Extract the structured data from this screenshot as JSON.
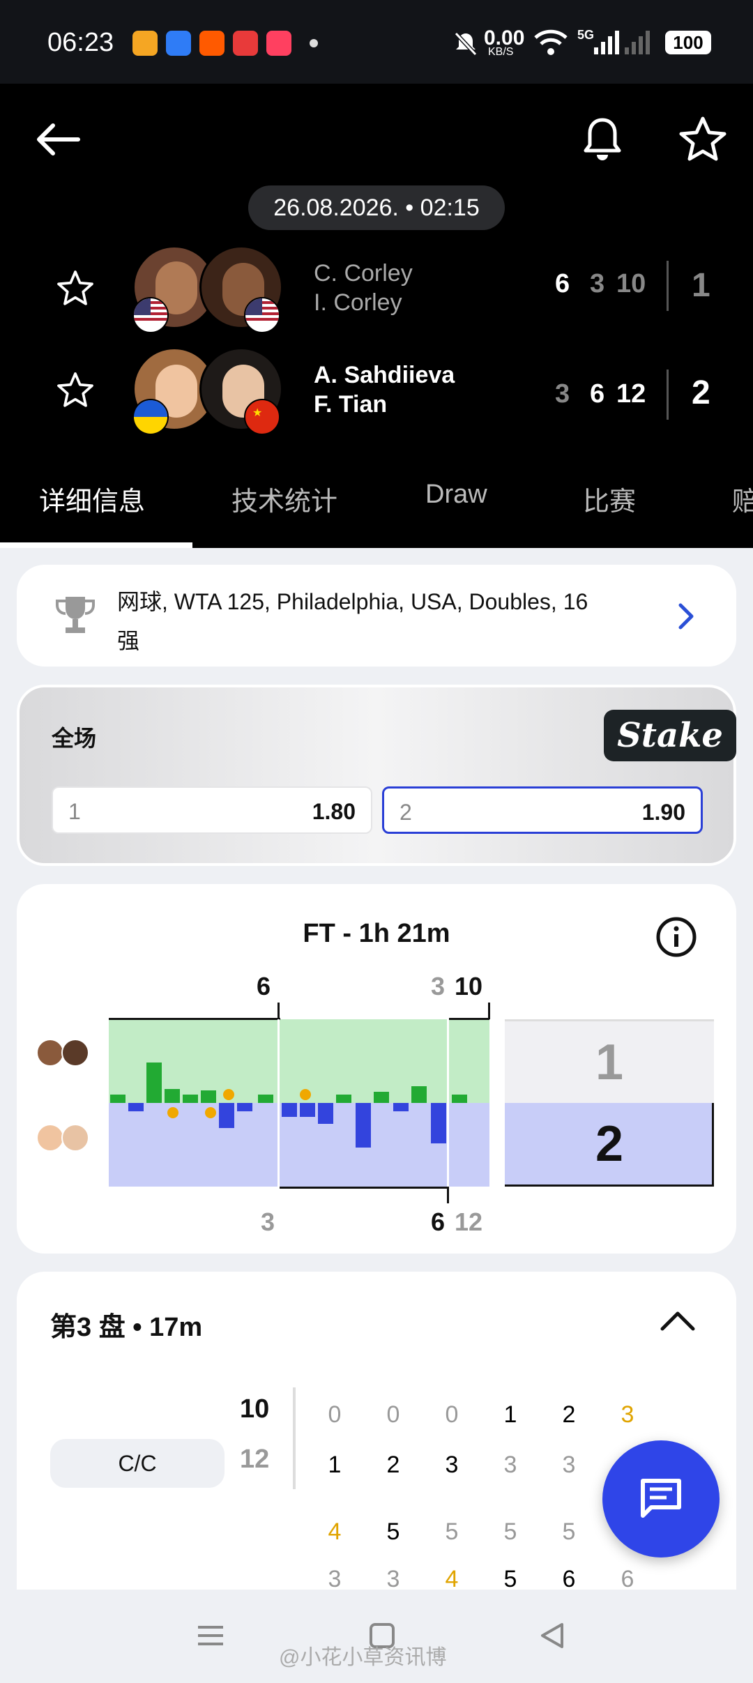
{
  "status_bar": {
    "time": "06:23",
    "net_speed": "0.00",
    "net_unit": "KB/S",
    "network": "5G",
    "battery": "100"
  },
  "match": {
    "datetime": "26.08.2026. • 02:15",
    "team1": {
      "player1": "C. Corley",
      "player2": "I. Corley",
      "sets": [
        "6",
        "3",
        "10"
      ],
      "total": "1"
    },
    "team2": {
      "player1": "A. Sahdiieva",
      "player2": "F. Tian",
      "sets": [
        "3",
        "6",
        "12"
      ],
      "total": "2"
    }
  },
  "tabs": [
    "详细信息",
    "技术统计",
    "Draw",
    "比赛",
    "赔"
  ],
  "tournament": {
    "text_line1": "网球, WTA 125, Philadelphia, USA, Doubles, 16",
    "text_line2": "强"
  },
  "odds": {
    "title": "全场",
    "brand": "Stake",
    "option1": {
      "label": "1",
      "value": "1.80"
    },
    "option2": {
      "label": "2",
      "value": "1.90"
    }
  },
  "momentum": {
    "title": "FT - 1h 21m",
    "top_labels": [
      "6",
      "3",
      "10"
    ],
    "bottom_labels": [
      "3",
      "6",
      "12"
    ],
    "result_top": "1",
    "result_bottom": "2"
  },
  "set3": {
    "title": "第3 盘 • 17m",
    "team_label": "C/C",
    "score_top": "10",
    "score_bottom": "12",
    "row1": [
      "0",
      "0",
      "0",
      "1",
      "2",
      "3"
    ],
    "row2": [
      "1",
      "2",
      "3",
      "3",
      "3"
    ],
    "row3": [
      "4",
      "5",
      "5",
      "5",
      "5"
    ],
    "row4": [
      "3",
      "3",
      "4",
      "5",
      "6",
      "6"
    ]
  },
  "watermark": "@小花小草资讯博"
}
